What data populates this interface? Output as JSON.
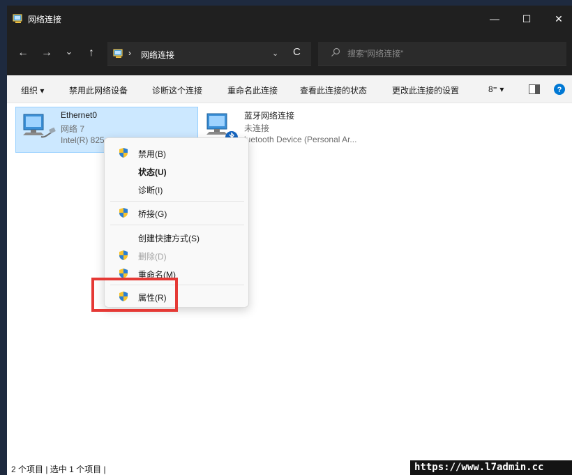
{
  "window": {
    "title": "网络连接",
    "minimize_glyph": "—",
    "maximize_glyph": "☐",
    "close_glyph": "✕"
  },
  "nav": {
    "back_glyph": "←",
    "forward_glyph": "→",
    "recent_glyph": "⌄",
    "up_glyph": "↑",
    "breadcrumb_sep": "›",
    "breadcrumb": "网络连接",
    "address_dropdown_glyph": "⌄",
    "refresh_glyph": "C",
    "search_placeholder": "搜索\"网络连接\""
  },
  "commandbar": {
    "organize": "组织 ▾",
    "disable_device": "禁用此网络设备",
    "diagnose": "诊断这个连接",
    "rename": "重命名此连接",
    "view_status": "查看此连接的状态",
    "change_settings": "更改此连接的设置",
    "view_glyph": "8⁼ ▾"
  },
  "connections": [
    {
      "name": "Ethernet0",
      "status": "网络 7",
      "device": "Intel(R) 825"
    },
    {
      "name": "蓝牙网络连接",
      "status": "未连接",
      "device": "luetooth Device (Personal Ar..."
    }
  ],
  "context_menu": {
    "items": [
      {
        "label": "禁用(B)",
        "shield": true,
        "bold": false,
        "disabled": false
      },
      {
        "label": "状态(U)",
        "shield": false,
        "bold": true,
        "disabled": false
      },
      {
        "label": "诊断(I)",
        "shield": false,
        "bold": false,
        "disabled": false
      },
      {
        "label": "桥接(G)",
        "shield": true,
        "bold": false,
        "disabled": false
      },
      {
        "label": "创建快捷方式(S)",
        "shield": false,
        "bold": false,
        "disabled": false
      },
      {
        "label": "删除(D)",
        "shield": true,
        "bold": false,
        "disabled": true
      },
      {
        "label": "重命名(M)",
        "shield": true,
        "bold": false,
        "disabled": false
      },
      {
        "label": "属性(R)",
        "shield": true,
        "bold": false,
        "disabled": false
      }
    ]
  },
  "statusbar": {
    "text": "2 个项目  |  选中 1 个项目  |"
  },
  "watermark": "https://www.l7admin.cc",
  "colors": {
    "titlebar": "#202020",
    "selection": "#cce8ff",
    "highlight_border": "#e53935",
    "help_icon": "#0078d4"
  }
}
